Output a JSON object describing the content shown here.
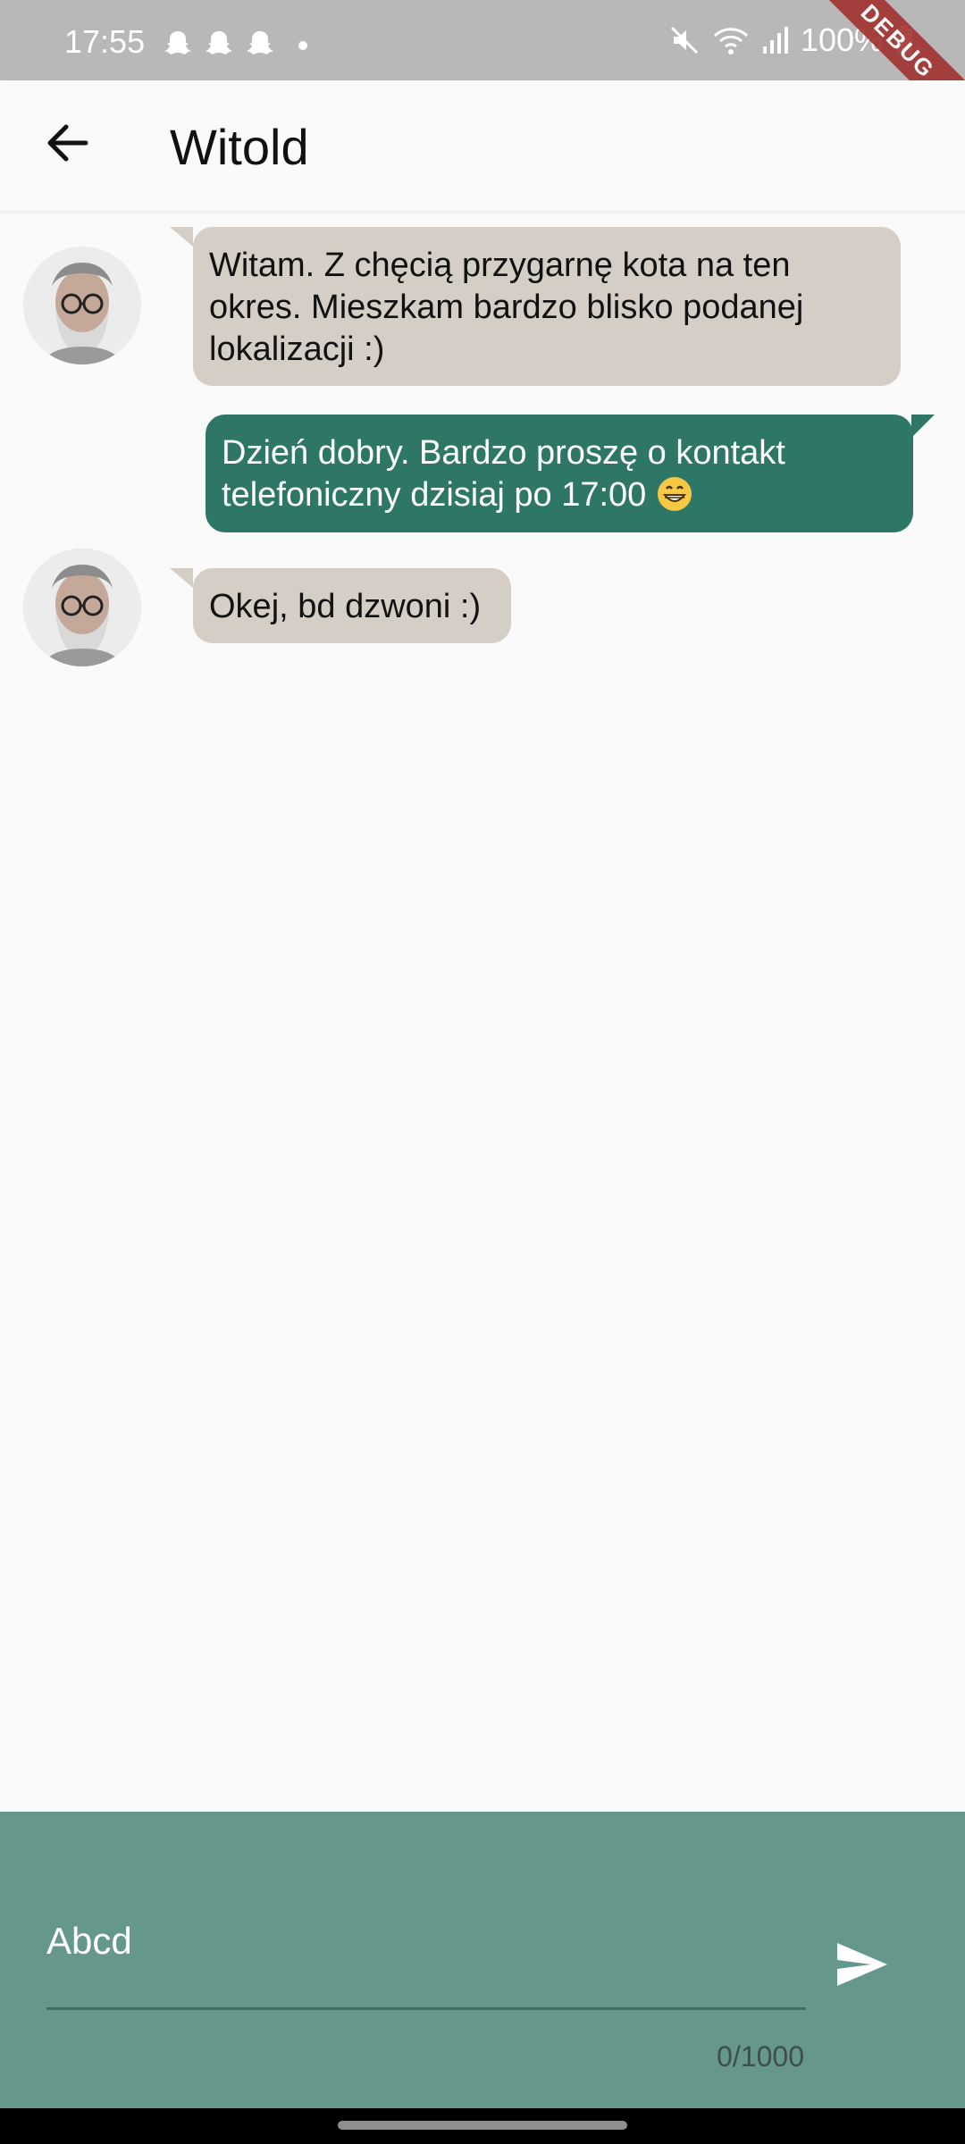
{
  "status_bar": {
    "time": "17:55",
    "battery": "100%",
    "notification_icons": [
      "snapchat-icon",
      "snapchat-icon",
      "snapchat-icon"
    ],
    "status_icons": [
      "mute-icon",
      "wifi-icon",
      "signal-icon",
      "battery-icon"
    ]
  },
  "debug_banner": "DEBUG",
  "app_bar": {
    "title": "Witold",
    "back_icon": "arrow-back-icon"
  },
  "messages": [
    {
      "direction": "incoming",
      "text": "Witam. Z chęcią przygarnę kota na ten okres. Mieszkam bardzo blisko podanej lokalizacji :)"
    },
    {
      "direction": "outgoing",
      "text": "Dzień dobry. Bardzo proszę o kontakt telefoniczny dzisiaj po 17:00",
      "emoji": "grinning-face-icon"
    },
    {
      "direction": "incoming",
      "text": "Okej, bd dzwoni :)"
    }
  ],
  "composer": {
    "value": "Abcd",
    "counter": "0/1000",
    "send_icon": "send-icon"
  },
  "colors": {
    "incoming_bubble": "#d4cec6",
    "outgoing_bubble": "#2e7766",
    "composer_bg": "#65978a",
    "status_bar_bg": "#b8b8b8"
  }
}
